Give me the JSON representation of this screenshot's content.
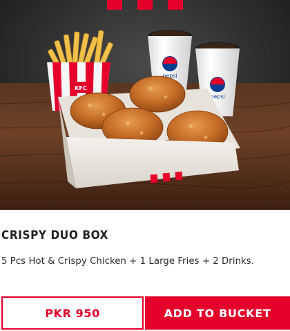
{
  "product": {
    "image_alt": "KFC Crispy Duo Box",
    "title": "CRISPY DUO BOX",
    "description": "5 Pcs Hot & Crispy Chicken + 1 Large Fries + 2 Drinks.",
    "price": "PKR 950",
    "add_label": "ADD TO BUCKET"
  },
  "image_text": {
    "fries_brand": "KFC",
    "cup_brand_1": "pepsi",
    "cup_brand_2": "pepsi"
  },
  "colors": {
    "accent": "#e4002b",
    "text": "#202124"
  }
}
